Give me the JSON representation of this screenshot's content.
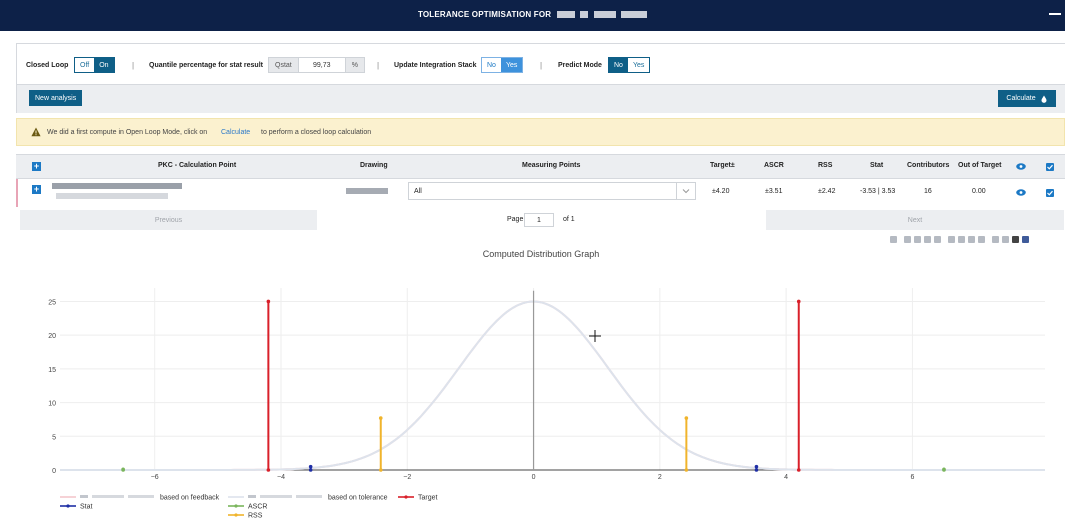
{
  "header": {
    "title": "TOLERANCE OPTIMISATION FOR",
    "minimize_icon": "minimize-icon"
  },
  "options": {
    "closed_loop_label": "Closed Loop",
    "closed_loop_off": "Off",
    "closed_loop_on": "On",
    "closed_loop_selected": "On",
    "quantile_label": "Quantile percentage for stat result",
    "qstat_prefix": "Qstat",
    "qstat_value": "99,73",
    "qstat_suffix": "%",
    "update_stack_label": "Update Integration Stack",
    "update_no": "No",
    "update_yes": "Yes",
    "update_selected": "Yes",
    "predict_label": "Predict Mode",
    "predict_no": "No",
    "predict_yes": "Yes",
    "predict_selected": "No",
    "separator": "|"
  },
  "actions": {
    "new_analysis": "New analysis",
    "calculate": "Calculate"
  },
  "alert": {
    "text_before": "We did a first compute in Open Loop Mode, click on",
    "link": "Calculate",
    "text_after": "to perform a closed loop calculation"
  },
  "table": {
    "headers": {
      "pkc": "PKC - Calculation Point",
      "drawing": "Drawing",
      "measuring_points": "Measuring Points",
      "target": "Target±",
      "ascr": "ASCR",
      "rss": "RSS",
      "stat": "Stat",
      "contributors": "Contributors",
      "out_of_target": "Out of Target"
    },
    "row": {
      "measuring_points": "All",
      "target": "±4.20",
      "ascr": "±3.51",
      "rss": "±2.42",
      "stat": "-3.53 | 3.53",
      "contributors": "16",
      "out_of_target": "0.00"
    }
  },
  "pager": {
    "previous": "Previous",
    "page_label": "Page",
    "page_value": "1",
    "of_label": "of 1",
    "next": "Next"
  },
  "chart_data": {
    "type": "line",
    "title": "Computed Distribution Graph",
    "xlim": [
      -7.5,
      8.1
    ],
    "ylim": [
      0,
      27
    ],
    "x_ticks": [
      -6,
      -4,
      -2,
      0,
      2,
      4,
      6
    ],
    "y_ticks": [
      0,
      5,
      10,
      15,
      20,
      25
    ],
    "grid": true,
    "series": [
      {
        "name": "based on feedback",
        "color": "#f4c7cc",
        "kind": "gaussian",
        "mean": 0,
        "sigma": 1.18,
        "peak": 25
      },
      {
        "name": "based on tolerance",
        "color": "#dde3ec",
        "kind": "gaussian",
        "mean": 0,
        "sigma": 1.18,
        "peak": 25
      },
      {
        "name": "Target",
        "color": "#d9202a",
        "kind": "stems",
        "x": [
          -4.2,
          4.2
        ],
        "y": [
          25,
          25
        ]
      },
      {
        "name": "Stat",
        "color": "#1f2fa5",
        "kind": "stems",
        "x": [
          -3.53,
          3.53
        ],
        "y": [
          0.5,
          0.5
        ]
      },
      {
        "name": "ASCR",
        "color": "#7ab55c",
        "kind": "stems",
        "x": [
          -6.5,
          6.5
        ],
        "y": [
          0.1,
          0.1
        ]
      },
      {
        "name": "RSS",
        "color": "#f0b42c",
        "kind": "stems",
        "x": [
          -2.42,
          2.42
        ],
        "y": [
          7.7,
          7.7
        ]
      }
    ],
    "center_line_x": 0,
    "legend_position": "bottom-left"
  }
}
